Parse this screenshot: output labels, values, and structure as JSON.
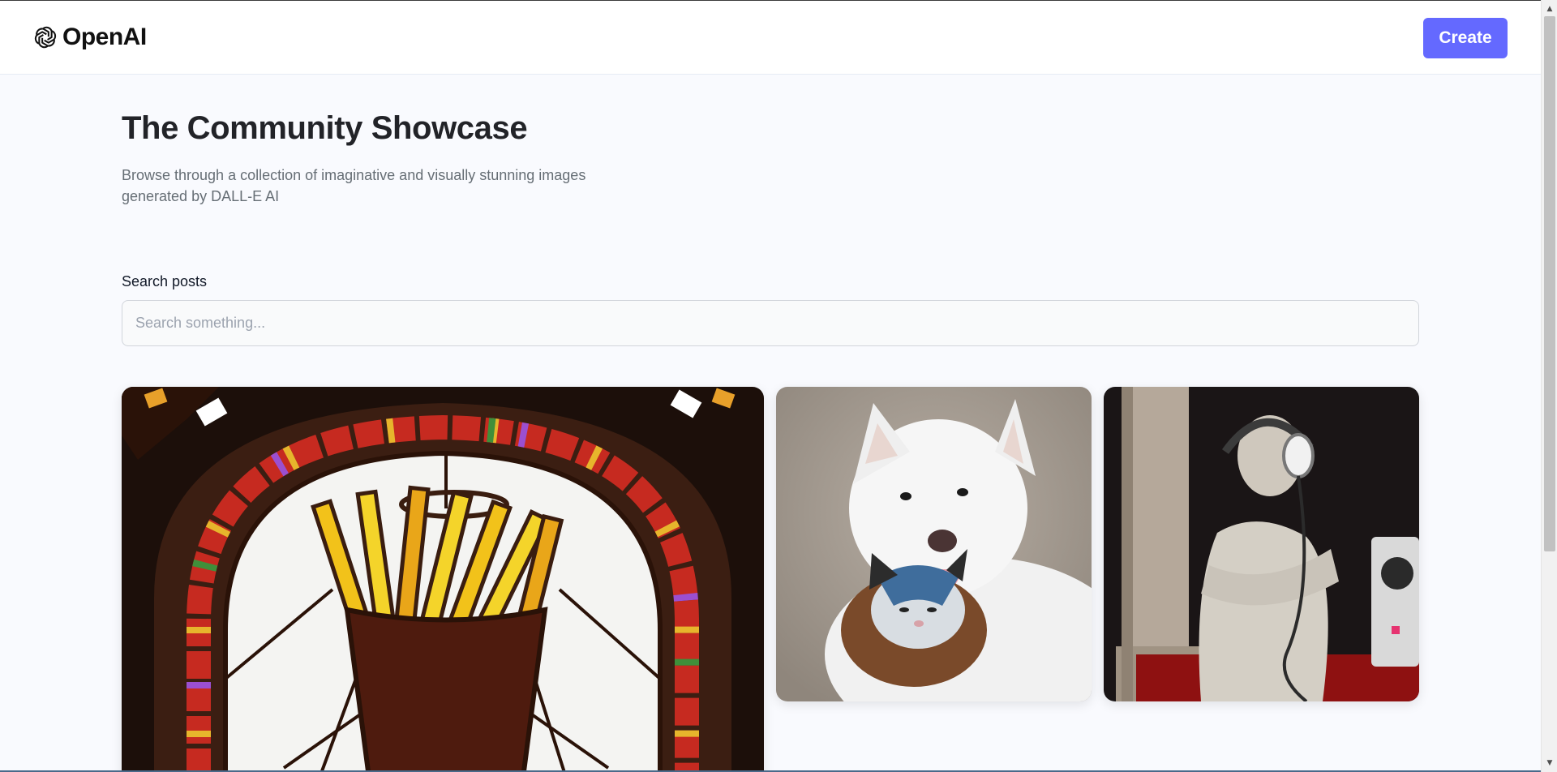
{
  "header": {
    "logo_text": "OpenAI",
    "create_label": "Create"
  },
  "hero": {
    "title": "The Community Showcase",
    "subtitle": "Browse through a collection of imaginative and visually stunning images generated by DALL-E AI"
  },
  "search": {
    "label": "Search posts",
    "placeholder": "Search something...",
    "value": ""
  },
  "gallery": {
    "posts": [
      {
        "subject": "stained-glass-fries"
      },
      {
        "subject": "dog-and-cat"
      },
      {
        "subject": "statue-with-headphones"
      }
    ]
  },
  "colors": {
    "accent": "#6469ff",
    "background": "#f9fafe",
    "title": "#222328",
    "subtitle": "#666e75"
  }
}
